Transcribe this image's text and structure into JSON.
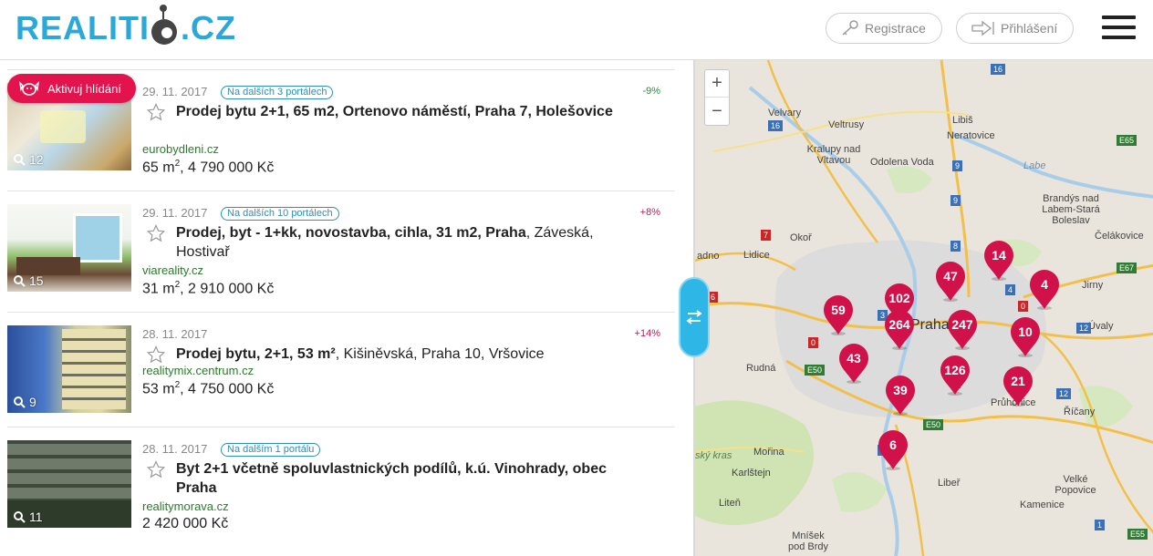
{
  "header": {
    "logo_left": "REALITI",
    "logo_right": ".CZ",
    "register_label": "Registrace",
    "login_label": "Přihlášení"
  },
  "alert_button_label": "Aktivuj hlídání",
  "listings": [
    {
      "date": "29. 11. 2017",
      "portals": "Na dalších 3 portálech",
      "change": "-9%",
      "change_color": "#2b8a3e",
      "title_bold": "Prodej bytu 2+1, 65 m2, Ortenovo náměstí, Praha 7, Holešovice",
      "title_rest": "",
      "source": "eurobydleni.cz",
      "price_area": "65 m",
      "price_sup": "2",
      "price_value": ", 4 790 000 Kč",
      "photos": "12"
    },
    {
      "date": "29. 11. 2017",
      "portals": "Na dalších 10 portálech",
      "change": "+8%",
      "change_color": "#c2185b",
      "title_bold": "Prodej, byt - 1+kk, novostavba, cihla, 31 m2, Praha",
      "title_rest": ", Záveská, Hostivař",
      "source": "viareality.cz",
      "price_area": "31 m",
      "price_sup": "2",
      "price_value": ", 2 910 000 Kč",
      "photos": "15"
    },
    {
      "date": "28. 11. 2017",
      "portals": "",
      "change": "+14%",
      "change_color": "#c2185b",
      "title_bold": "Prodej bytu, 2+1, 53 m²",
      "title_rest": ", Kišiněvská, Praha 10, Vršovice",
      "source": "realitymix.centrum.cz",
      "price_area": "53 m",
      "price_sup": "2",
      "price_value": ", 4 750 000 Kč",
      "photos": "9"
    },
    {
      "date": "28. 11. 2017",
      "portals": "Na dalším 1 portálu",
      "change": "",
      "change_color": "#c2185b",
      "title_bold": "Byt 2+1 včetně spoluvlastnických podílů, k.ú. Vinohrady, obec Praha",
      "title_rest": "",
      "source": "realitymorava.cz",
      "price_area": "",
      "price_sup": "",
      "price_value": "2 420 000 Kč",
      "photos": "11"
    }
  ],
  "map": {
    "zoom_in": "+",
    "zoom_out": "−",
    "places": [
      "Velvary",
      "Veltrusy",
      "Libiš",
      "Neratovice",
      "Kralupy nad Vltavou",
      "Odolena Voda",
      "Labe",
      "Brandýs nad Labem-Stará Boleslav",
      "Čelákovice",
      "Okoř",
      "Lidice",
      "adno",
      "Jirny",
      "Praha",
      "Úvaly",
      "Rudná",
      "Průhonice",
      "Říčany",
      "ský kras",
      "Mořina",
      "Karlštejn",
      "Liteň",
      "Velké Popovice",
      "Libeř",
      "Kamenice",
      "Mníšek pod Brdy",
      "E65",
      "E67",
      "E50",
      "E50",
      "E55"
    ],
    "road_numbers": [
      "16",
      "16",
      "9",
      "9",
      "8",
      "7",
      "6",
      "0",
      "0",
      "12",
      "12",
      "4",
      "1",
      "2",
      "3",
      "4"
    ],
    "clusters": [
      "14",
      "47",
      "4",
      "102",
      "59",
      "264",
      "247",
      "10",
      "43",
      "126",
      "21",
      "39",
      "6"
    ],
    "pin_color": "#d1124a"
  }
}
